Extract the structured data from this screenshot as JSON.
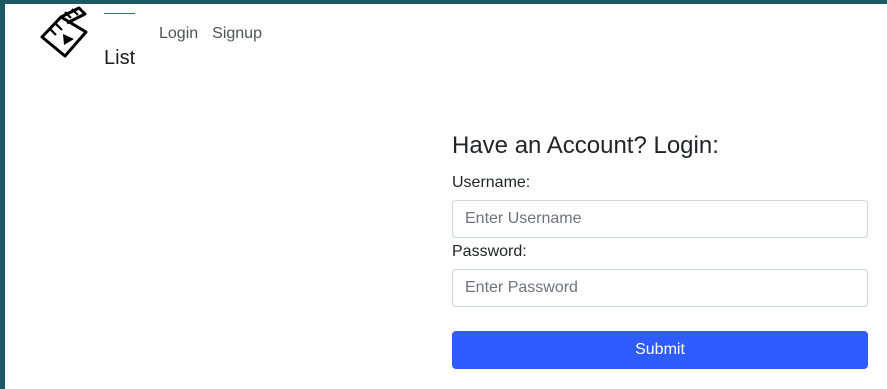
{
  "header": {
    "logo_icon": "clapperboard-play-icon",
    "active_nav": "List",
    "nav": [
      {
        "label": "Login"
      },
      {
        "label": "Signup"
      }
    ]
  },
  "login": {
    "title": "Have an Account? Login:",
    "username_label": "Username:",
    "username_placeholder": "Enter Username",
    "password_label": "Password:",
    "password_placeholder": "Enter Password",
    "submit_label": "Submit"
  },
  "colors": {
    "frame_background": "#1b5a63",
    "active_indicator": "#2d5bff",
    "submit_button": "#2f5cff",
    "input_border": "#ced4da"
  }
}
